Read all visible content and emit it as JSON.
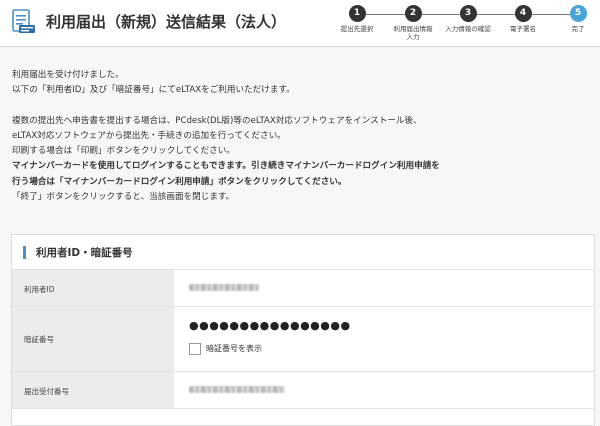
{
  "header": {
    "title": "利用届出（新規）送信結果（法人）",
    "steps": [
      {
        "number": "1",
        "label": "提出先選択",
        "active": false
      },
      {
        "number": "2",
        "label": "利用届出情報\n入力",
        "active": false
      },
      {
        "number": "3",
        "label": "入力情報の確認",
        "active": false
      },
      {
        "number": "4",
        "label": "電子署名",
        "active": false
      },
      {
        "number": "5",
        "label": "完了",
        "active": true
      }
    ]
  },
  "message": {
    "line1": "利用届出を受け付けました。",
    "line2": "以下の「利用者ID」及び「暗証番号」にてeLTAXをご利用いただけます。",
    "line3": "複数の提出先へ申告書を提出する場合は、PCdesk(DL版)等のeLTAX対応ソフトウェアをインストール後、",
    "line4": "eLTAX対応ソフトウェアから提出先・手続きの追加を行ってください。",
    "line5": "印刷する場合は「印刷」ボタンをクリックしてください。",
    "line6": "マイナンバーカードを使用してログインすることもできます。引き続きマイナンバーカードログイン利用申請を",
    "line7": "行う場合は「マイナンバーカードログイン利用申請」ボタンをクリックしてください。",
    "line8": "「終了」ボタンをクリックすると、当該画面を閉じます。"
  },
  "panel": {
    "title": "利用者ID・暗証番号",
    "user_id_label": "利用者ID",
    "password_label": "暗証番号",
    "password_masked": "●●●●●●●●●●●●●●●●",
    "show_password_label": "暗証番号を表示",
    "receipt_label": "届出受付番号"
  }
}
